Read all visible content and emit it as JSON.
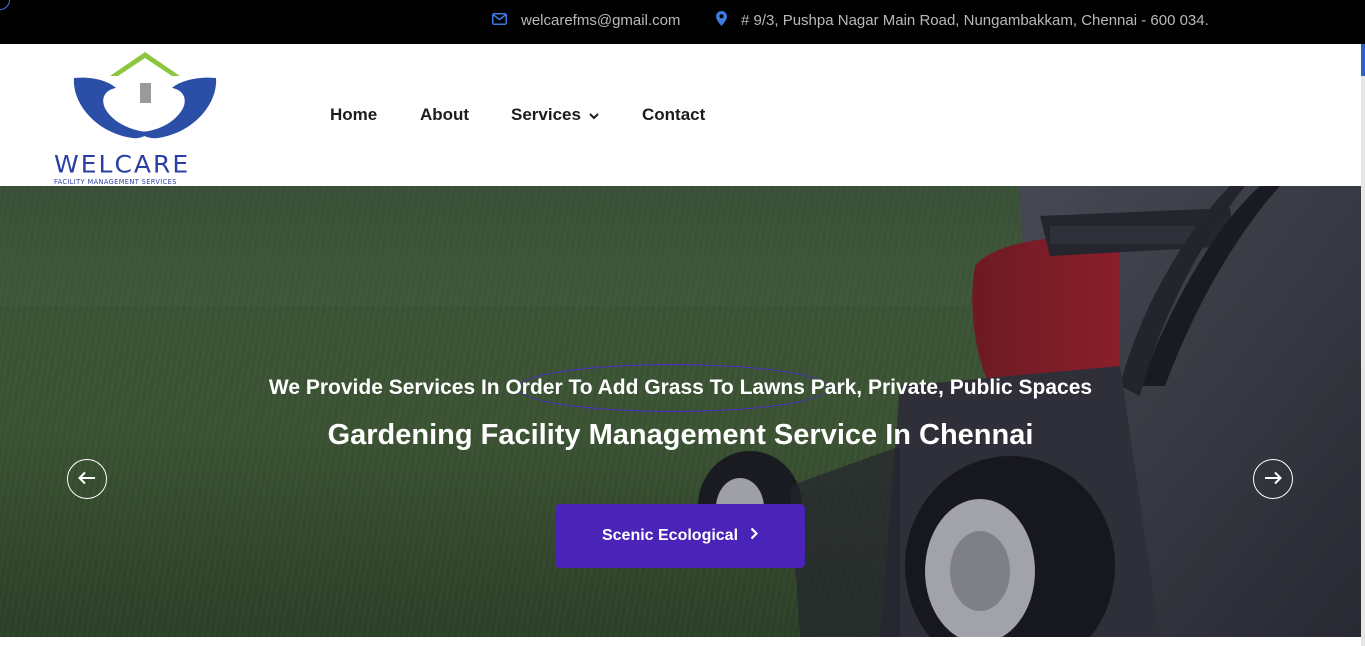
{
  "topbar": {
    "email": "welcarefms@gmail.com",
    "address": "# 9/3, Pushpa Nagar Main Road, Nungambakkam, Chennai - 600 034.",
    "email_icon": "envelope-icon",
    "address_icon": "map-pin-icon"
  },
  "logo": {
    "wordmark": "WELCARE",
    "tagline": "FACILITY MANAGEMENT SERVICES"
  },
  "nav": {
    "home": "Home",
    "about": "About",
    "services": "Services",
    "contact": "Contact"
  },
  "hero": {
    "subtitle": "We Provide Services In Order To Add Grass To Lawns Park, Private, Public Spaces",
    "title": "Gardening Facility Management Service In Chennai",
    "cta_label": "Scenic Ecological",
    "prev_icon": "arrow-left-icon",
    "next_icon": "arrow-right-icon"
  },
  "colors": {
    "topbar_bg": "#000000",
    "accent_purple": "#4a24b8",
    "brand_blue": "#2b3fa3",
    "brand_green": "#8cc63f"
  }
}
